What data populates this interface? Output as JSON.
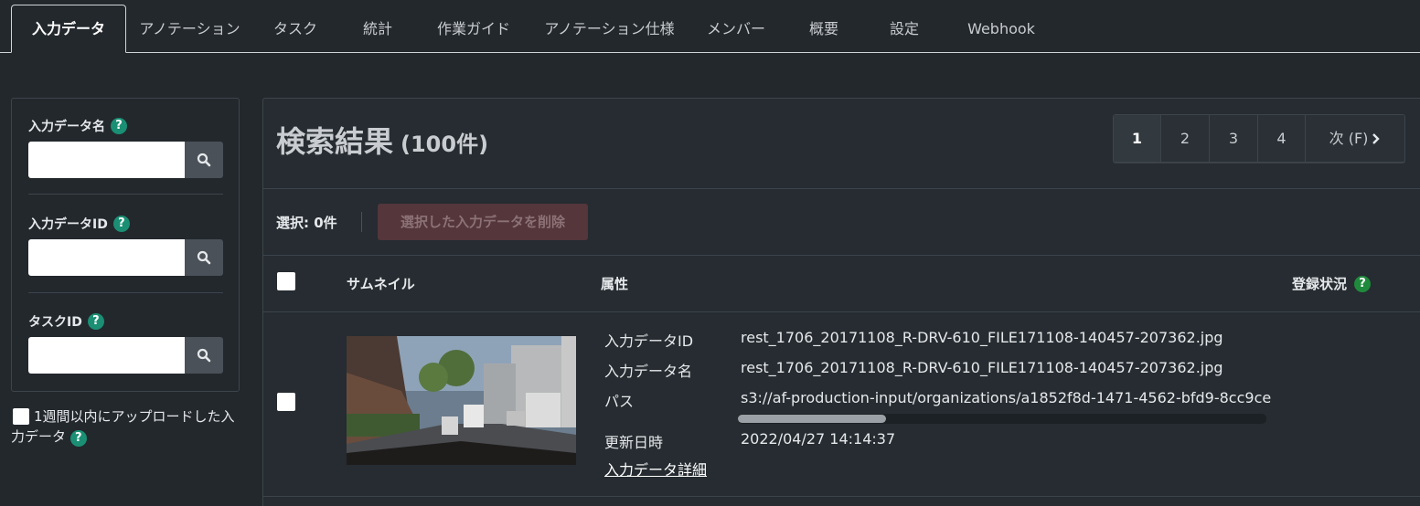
{
  "tabs": [
    {
      "label": "入力データ",
      "active": true
    },
    {
      "label": "アノテーション"
    },
    {
      "label": "タスク"
    },
    {
      "label": "統計"
    },
    {
      "label": "作業ガイド"
    },
    {
      "label": "アノテーション仕様"
    },
    {
      "label": "メンバー"
    },
    {
      "label": "概要"
    },
    {
      "label": "設定"
    },
    {
      "label": "Webhook"
    }
  ],
  "filters": {
    "input_name_label": "入力データ名",
    "input_id_label": "入力データID",
    "task_id_label": "タスクID",
    "week_label": "1週間以内にアップロードした入力データ",
    "help_glyph": "?"
  },
  "results": {
    "title": "検索結果",
    "count": "(100件)",
    "pages": [
      "1",
      "2",
      "3",
      "4"
    ],
    "current_page": "1",
    "next_label": "次 (F)",
    "selection": "選択: 0件",
    "delete_button": "選択した入力データを削除"
  },
  "table": {
    "headers": {
      "thumbnail": "サムネイル",
      "attributes": "属性",
      "status": "登録状況"
    },
    "rows": [
      {
        "attributes": [
          {
            "key": "入力データID",
            "value": "rest_1706_20171108_R-DRV-610_FILE171108-140457-207362.jpg"
          },
          {
            "key": "入力データ名",
            "value": "rest_1706_20171108_R-DRV-610_FILE171108-140457-207362.jpg"
          },
          {
            "key": "パス",
            "value": "s3://af-production-input/organizations/a1852f8d-1471-4562-bfd9-8cc9ce"
          },
          {
            "key": "更新日時",
            "value": "2022/04/27 14:14:37"
          }
        ],
        "detail_link": "入力データ詳細",
        "path_scroll_fraction": 0.28
      }
    ]
  },
  "colors": {
    "background": "#23282d",
    "help_icon": "#1a8f74",
    "delete_button": "#54363b"
  }
}
